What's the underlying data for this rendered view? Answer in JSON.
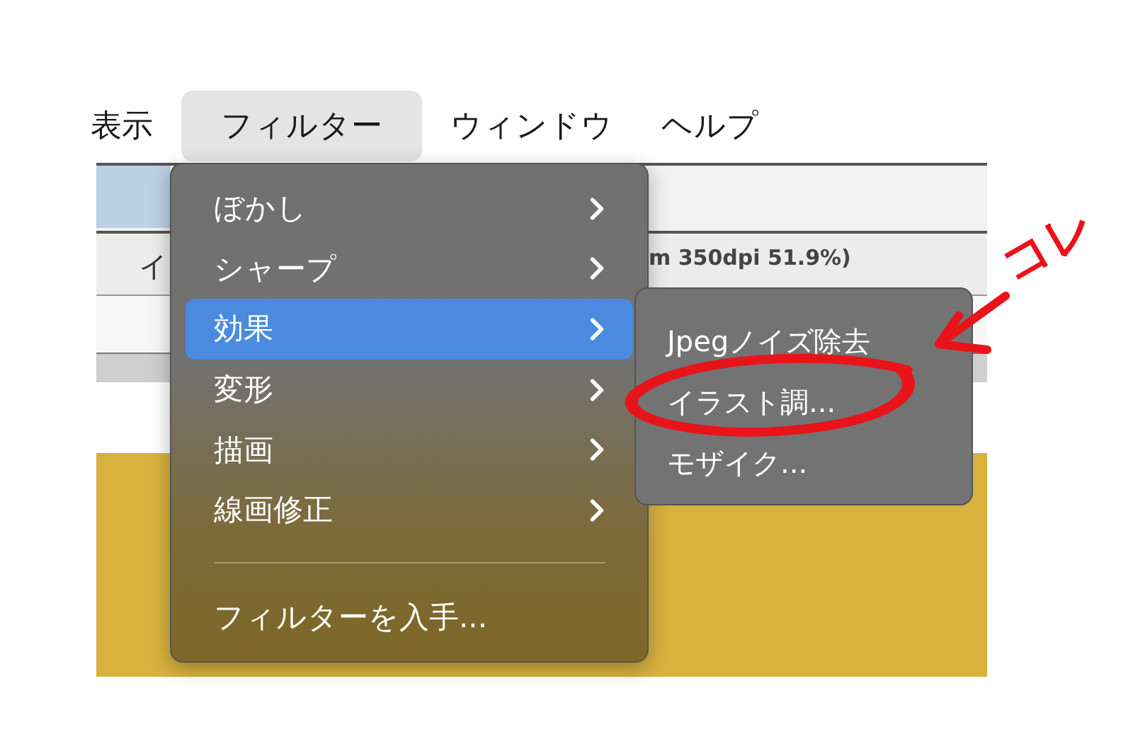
{
  "menu_bar": [
    {
      "label": "表示",
      "selected": false
    },
    {
      "label": "フィルター",
      "selected": true
    },
    {
      "label": "ウィンドウ",
      "selected": false
    },
    {
      "label": "ヘルプ",
      "selected": false
    }
  ],
  "document": {
    "row_label": "イ",
    "info": "m 350dpi 51.9%)"
  },
  "filter_menu": {
    "items": [
      {
        "kind": "submenu",
        "label": "ぼかし",
        "selected": false
      },
      {
        "kind": "submenu",
        "label": "シャープ",
        "selected": false
      },
      {
        "kind": "submenu",
        "label": "効果",
        "selected": true
      },
      {
        "kind": "submenu",
        "label": "変形",
        "selected": false
      },
      {
        "kind": "submenu",
        "label": "描画",
        "selected": false
      },
      {
        "kind": "submenu",
        "label": "線画修正",
        "selected": false
      },
      {
        "kind": "separator"
      },
      {
        "kind": "action",
        "label": "フィルターを入手..."
      }
    ]
  },
  "effects_submenu": {
    "items": [
      {
        "label": "Jpegノイズ除去"
      },
      {
        "label": "イラスト調..."
      },
      {
        "label": "モザイク..."
      }
    ]
  },
  "annotation": {
    "text": "コレ"
  }
}
